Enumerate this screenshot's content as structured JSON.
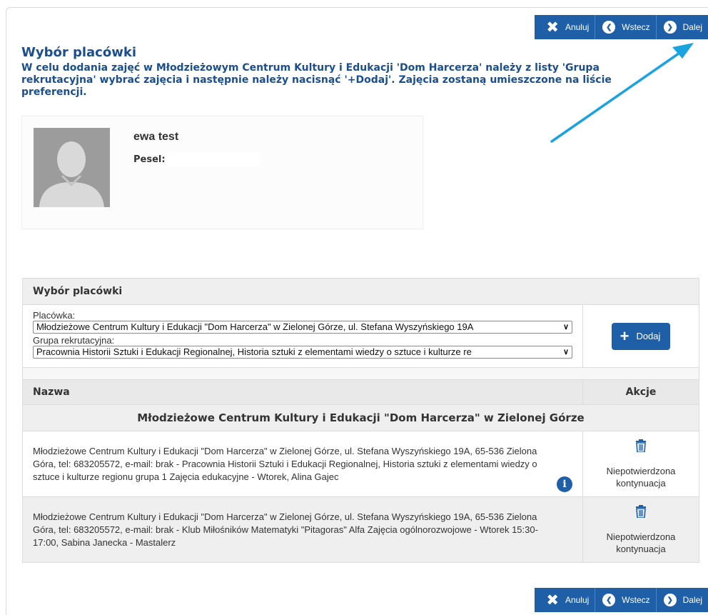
{
  "nav": {
    "cancel": "Anuluj",
    "back": "Wstecz",
    "next": "Dalej"
  },
  "page": {
    "title": "Wybór placówki",
    "instruction": "W celu dodania zajęć w Młodzieżowym Centrum Kultury i Edukacji 'Dom Harcerza' należy z listy 'Grupa rekrutacyjna' wybrać zajęcia i następnie należy nacisnąć '+Dodaj'. Zajęcia zostaną umieszczone na liście preferencji."
  },
  "profile": {
    "name": "ewa test",
    "pesel_label": "Pesel:"
  },
  "selection": {
    "header": "Wybór placówki",
    "placowka_label": "Placówka:",
    "placowka_value": "Młodzieżowe Centrum Kultury i Edukacji \"Dom Harcerza\" w Zielonej Górze, ul. Stefana Wyszyńskiego 19A",
    "grupa_label": "Grupa rekrutacyjna:",
    "grupa_value": "Pracownia Historii Sztuki i Edukacji Regionalnej, Historia sztuki z elementami wiedzy o sztuce i kulturze re",
    "add_label": "Dodaj"
  },
  "table": {
    "col_name": "Nazwa",
    "col_actions": "Akcje",
    "group_title": "Młodzieżowe Centrum Kultury i Edukacji \"Dom Harcerza\" w Zielonej Górze",
    "rows": [
      {
        "text": "Młodzieżowe Centrum Kultury i Edukacji \"Dom Harcerza\" w Zielonej Górze, ul. Stefana Wyszyńskiego 19A, 65-536 Zielona Góra, tel: 683205572, e-mail: brak - Pracownia Historii Sztuki i Edukacji Regionalnej, Historia sztuki z elementami wiedzy o sztuce i kulturze regionu grupa 1 Zajęcia edukacyjne - Wtorek, Alina Gajec",
        "status": "Niepotwierdzona kontynuacja"
      },
      {
        "text": "Młodzieżowe Centrum Kultury i Edukacji \"Dom Harcerza\" w Zielonej Górze, ul. Stefana Wyszyńskiego 19A, 65-536 Zielona Góra, tel: 683205572, e-mail: brak - Klub Miłośników Matematyki \"Pitagoras\" Alfa Zajęcia ogólnorozwojowe - Wtorek 15:30-17:00, Sabina Janecka - Mastalerz",
        "status": "Niepotwierdzona kontynuacja"
      }
    ]
  },
  "icons": {
    "cancel": "x-icon",
    "back": "circle-chevron-left-icon",
    "next": "circle-chevron-right-icon",
    "add": "plus-icon",
    "delete": "trash-icon",
    "info": "info-icon",
    "avatar": "user-silhouette",
    "annotation": "arrow-annotation"
  },
  "colors": {
    "brand": "#1f5fa8",
    "title": "#1b4e8f",
    "arrow": "#1aa3df"
  }
}
